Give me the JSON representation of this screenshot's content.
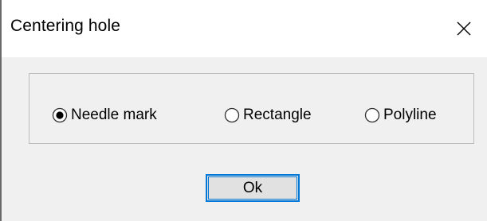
{
  "window": {
    "title": "Centering hole"
  },
  "icons": {
    "close": "close-icon"
  },
  "options": [
    {
      "label": "Needle mark",
      "selected": true
    },
    {
      "label": "Rectangle",
      "selected": false
    },
    {
      "label": "Polyline",
      "selected": false
    }
  ],
  "actions": {
    "ok_label": "Ok"
  },
  "colors": {
    "accent": "#0078d7",
    "titlebar": "#ffffff",
    "body": "#f0f0f0",
    "button_face": "#e1e1e1"
  }
}
